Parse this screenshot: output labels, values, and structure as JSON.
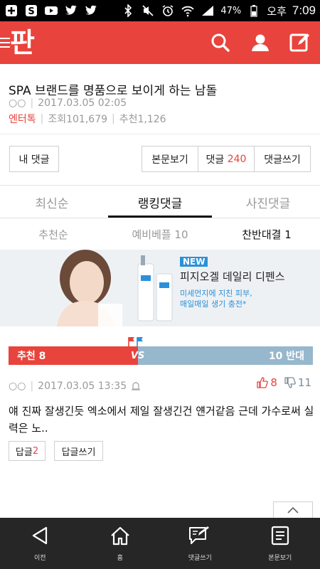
{
  "status_bar": {
    "battery_percent": "47%",
    "ampm": "오후",
    "time": "7:09"
  },
  "header": {
    "logo_text": "판",
    "brand_color": "#e8433c"
  },
  "article": {
    "title": "SPA 브랜드를 명품으로 보이게 하는 남돌",
    "author": "○○",
    "datetime": "2017.03.05 02:05",
    "category": "엔터톡",
    "views": "조회101,679",
    "recommends": "추천1,126"
  },
  "actions": {
    "my_comments": "내 댓글",
    "view_post": "본문보기",
    "comments_label": "댓글",
    "comments_count": "240",
    "write_comment": "댓글쓰기"
  },
  "tabs": [
    {
      "label": "최신순",
      "active": false
    },
    {
      "label": "랭킹댓글",
      "active": true
    },
    {
      "label": "사진댓글",
      "active": false
    }
  ],
  "subtabs": [
    {
      "label": "추천순",
      "active": false
    },
    {
      "label": "예비베플 10",
      "active": false
    },
    {
      "label": "찬반대결 1",
      "active": true
    }
  ],
  "ad": {
    "badge": "NEW",
    "title": "피지오겔 데일리 디펜스",
    "line1": "미세먼지에 지친 피부,",
    "line2": "매일매일 생기 충전*"
  },
  "vote_bar": {
    "up_label": "추천 8",
    "vs": "VS",
    "down_label": "10 반대",
    "up_color": "#e8433c",
    "down_color": "#97b7cd"
  },
  "comment": {
    "author": "○○",
    "datetime": "2017.03.05 13:35",
    "likes": "8",
    "dislikes": "11",
    "text": "얘 진짜 잘생긴듯 엑소에서 제일 잘생긴건 얜거같음 근데 가수로써 실력은 노..",
    "reply_label": "답글",
    "reply_count": "2",
    "write_reply": "답글쓰기"
  },
  "bottom_nav": [
    {
      "label": "이전",
      "icon": "back-icon"
    },
    {
      "label": "홈",
      "icon": "home-icon"
    },
    {
      "label": "댓글쓰기",
      "icon": "write-comment-icon"
    },
    {
      "label": "본문보기",
      "icon": "document-icon"
    }
  ]
}
